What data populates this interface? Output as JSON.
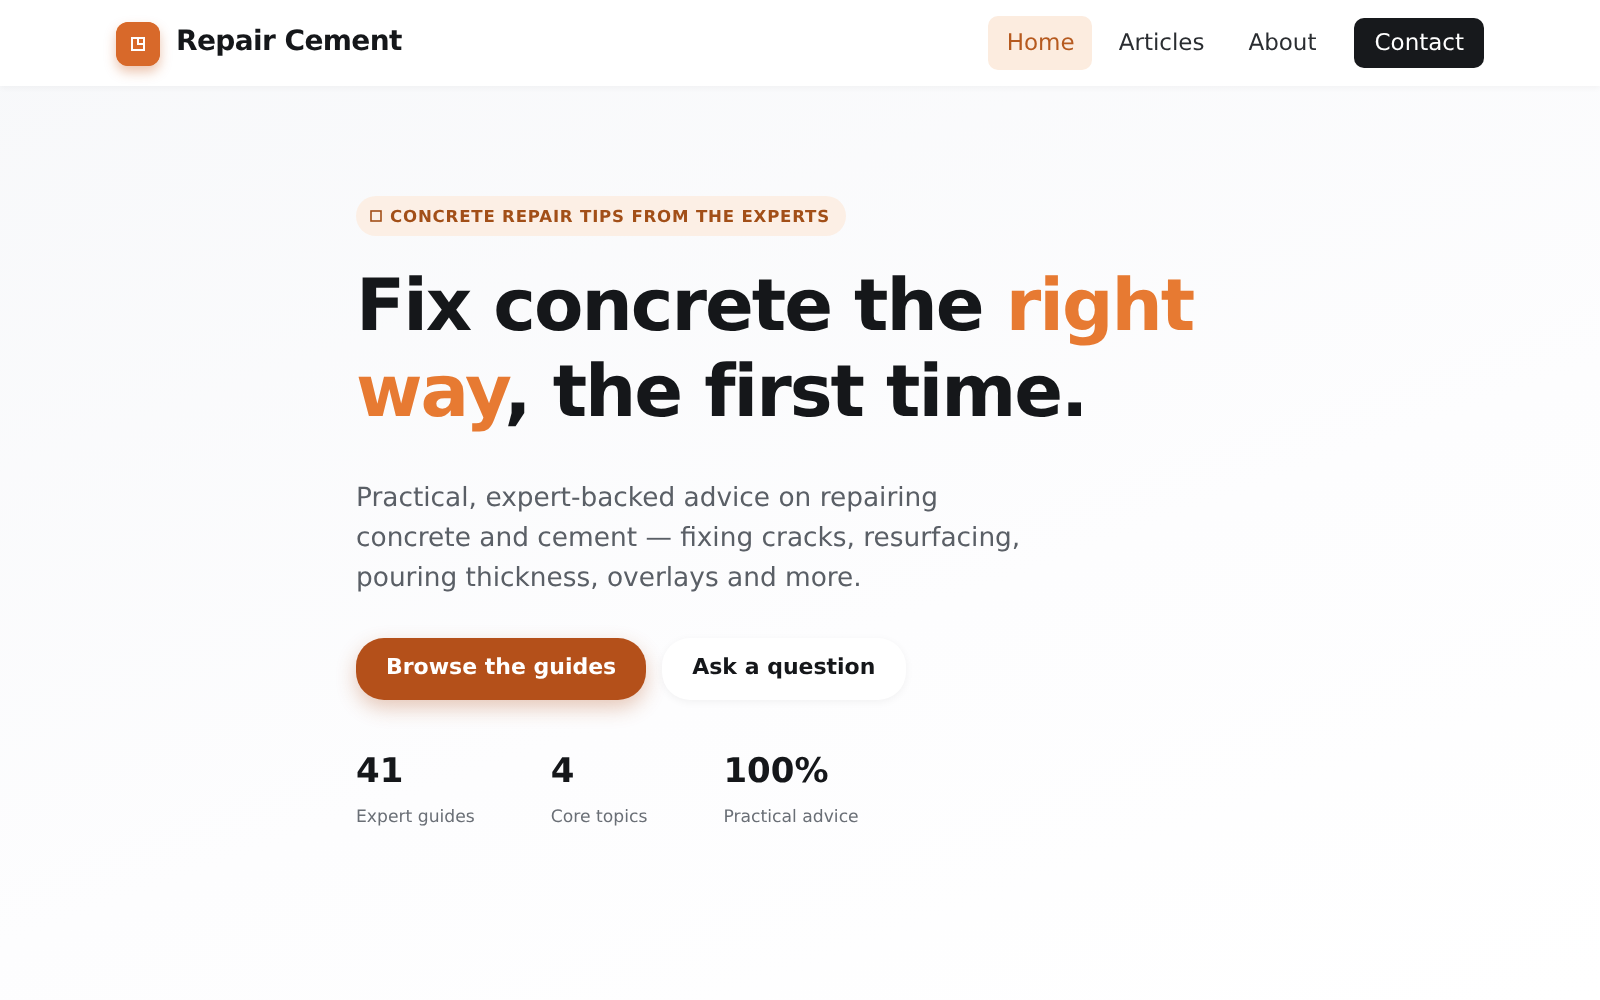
{
  "brand": {
    "name": "Repair Cement"
  },
  "nav": [
    {
      "label": "Home",
      "selected": true
    },
    {
      "label": "Articles",
      "selected": false
    },
    {
      "label": "About",
      "selected": false
    }
  ],
  "nav_button": "Contact",
  "hero": {
    "eyebrow": "CONCRETE REPAIR TIPS FROM THE EXPERTS",
    "headline": {
      "lead": "Fix concrete the ",
      "highlight": "right way",
      "tail": ", the first time."
    },
    "text": "Practical, expert-backed advice on repairing concrete and cement — fixing cracks, resurfacing, pouring thickness, overlays and more.",
    "buttons": [
      {
        "label": "Browse the guides",
        "kind": "primary"
      },
      {
        "label": "Ask a question",
        "kind": "secondary"
      }
    ],
    "stats": [
      {
        "value": "41",
        "label": "Expert guides"
      },
      {
        "value": "4",
        "label": "Core topics"
      },
      {
        "value": "100%",
        "label": "Practical advice"
      }
    ]
  }
}
